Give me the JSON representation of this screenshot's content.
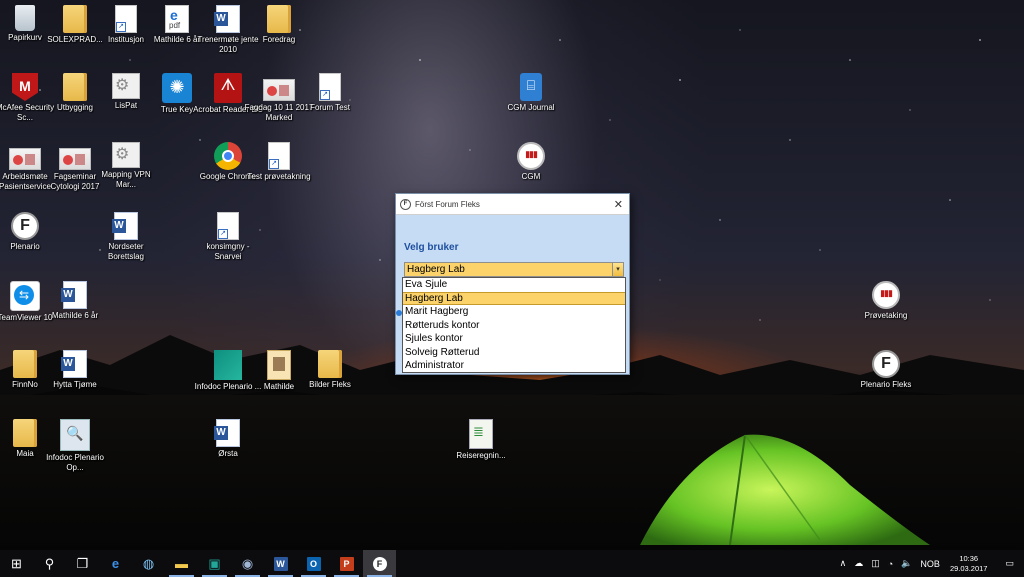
{
  "desktop_icons": [
    {
      "name": "recycle-bin",
      "label": "Papirkurv",
      "icon": "recycle-bin-icon"
    },
    {
      "name": "solexpr",
      "label": "SOLEXPRAD...",
      "icon": "folder-icon"
    },
    {
      "name": "institusjon",
      "label": "Institusjon",
      "icon": "document-icon"
    },
    {
      "name": "mathilde6-pdf",
      "label": "Mathilde 6 år",
      "icon": "pdf-icon"
    },
    {
      "name": "trenermote",
      "label": "Trenermøte jente 2010",
      "icon": "word-doc-icon"
    },
    {
      "name": "foredrag",
      "label": "Foredrag",
      "icon": "folder-icon"
    },
    {
      "name": "mcafee",
      "label": "McAfee Security Sc...",
      "icon": "mcafee-icon"
    },
    {
      "name": "utbygging",
      "label": "Utbygging",
      "icon": "folder-icon"
    },
    {
      "name": "lispat",
      "label": "LisPat",
      "icon": "app-icon"
    },
    {
      "name": "truekey",
      "label": "True Key",
      "icon": "truekey-icon"
    },
    {
      "name": "acrobat",
      "label": "Acrobat Reader DC",
      "icon": "acrobat-icon"
    },
    {
      "name": "fagdag",
      "label": "Fagdag 10 11 2017 Marked",
      "icon": "photo-icon"
    },
    {
      "name": "forumtest",
      "label": "Forum Test",
      "icon": "document-icon"
    },
    {
      "name": "cgm-journal",
      "label": "CGM Journal",
      "icon": "cgm-journal-icon"
    },
    {
      "name": "arbeidsmote",
      "label": "Arbeidsmøte Pasientservice",
      "icon": "photo-icon"
    },
    {
      "name": "fagseminar",
      "label": "Fagseminar Cytologi 2017",
      "icon": "photo-icon"
    },
    {
      "name": "mapping",
      "label": "Mapping VPN Mar...",
      "icon": "app-icon"
    },
    {
      "name": "chrome",
      "label": "Google Chrome",
      "icon": "chrome-icon"
    },
    {
      "name": "test-provetakning",
      "label": "Test prøvetakning",
      "icon": "document-icon"
    },
    {
      "name": "cgm",
      "label": "CGM",
      "icon": "test-tubes-icon"
    },
    {
      "name": "plenario",
      "label": "Plenario",
      "icon": "plenario-icon"
    },
    {
      "name": "nordseter",
      "label": "Nordseter Borettslag",
      "icon": "word-doc-icon"
    },
    {
      "name": "konsimgny",
      "label": "konsimgny - Snarvei",
      "icon": "document-icon"
    },
    {
      "name": "teamviewer",
      "label": "TeamViewer 10",
      "icon": "teamviewer-icon"
    },
    {
      "name": "mathilde6-word",
      "label": "Mathilde 6 år",
      "icon": "word-doc-icon"
    },
    {
      "name": "provetaking",
      "label": "Prøvetaking",
      "icon": "test-tubes-icon"
    },
    {
      "name": "finnno",
      "label": "FinnNo",
      "icon": "folder-icon"
    },
    {
      "name": "hytta",
      "label": "Hytta Tjøme",
      "icon": "word-doc-icon"
    },
    {
      "name": "infodoc-plenario",
      "label": "Infodoc Plenario ...",
      "icon": "infodoc-icon"
    },
    {
      "name": "mathilde",
      "label": "Mathilde",
      "icon": "folder-photo-icon"
    },
    {
      "name": "bilder-fleks",
      "label": "Bilder Fleks",
      "icon": "folder-icon"
    },
    {
      "name": "plenario-fleks",
      "label": "Plenario Fleks",
      "icon": "plenario-icon"
    },
    {
      "name": "maia",
      "label": "Maia",
      "icon": "folder-icon"
    },
    {
      "name": "infodoc-op",
      "label": "Infodoc Plenario Op...",
      "icon": "infodoc-search-icon"
    },
    {
      "name": "orsta",
      "label": "Ørsta",
      "icon": "word-doc-icon"
    },
    {
      "name": "reiseregning",
      "label": "Reiseregnin...",
      "icon": "spreadsheet-folder-icon"
    }
  ],
  "dialog": {
    "title": "Först Forum Fleks",
    "close_label": "✕",
    "heading": "Velg bruker",
    "selected_value": "Hagberg Lab",
    "dropdown_arrow": "▾",
    "options": [
      "Eva Sjule",
      "Hagberg Lab",
      "Marit Hagberg",
      "Røtteruds kontor",
      "Sjules kontor",
      "Solveig Røtterud",
      "Administrator"
    ],
    "selected_index": 1
  },
  "taskbar": {
    "items": [
      {
        "name": "start",
        "glyph": "⊞"
      },
      {
        "name": "search",
        "glyph": "⚲"
      },
      {
        "name": "task-view",
        "glyph": "❐"
      },
      {
        "name": "edge",
        "glyph": "e"
      },
      {
        "name": "maps",
        "glyph": "◍"
      },
      {
        "name": "file-explorer",
        "glyph": "▬"
      },
      {
        "name": "infodoc",
        "glyph": "▣"
      },
      {
        "name": "chrome",
        "glyph": "◉"
      },
      {
        "name": "word",
        "glyph": "W"
      },
      {
        "name": "outlook",
        "glyph": "O"
      },
      {
        "name": "powerpoint",
        "glyph": "P"
      },
      {
        "name": "forum-fleks",
        "glyph": "F"
      }
    ],
    "tray": {
      "chevron": "∧",
      "language": "NOB",
      "time": "10:36",
      "date": "29.03.2017"
    }
  },
  "colors": {
    "dialog_bg": "#c6dcf5",
    "selection": "#fcd36a",
    "heading": "#1f4fa0"
  }
}
